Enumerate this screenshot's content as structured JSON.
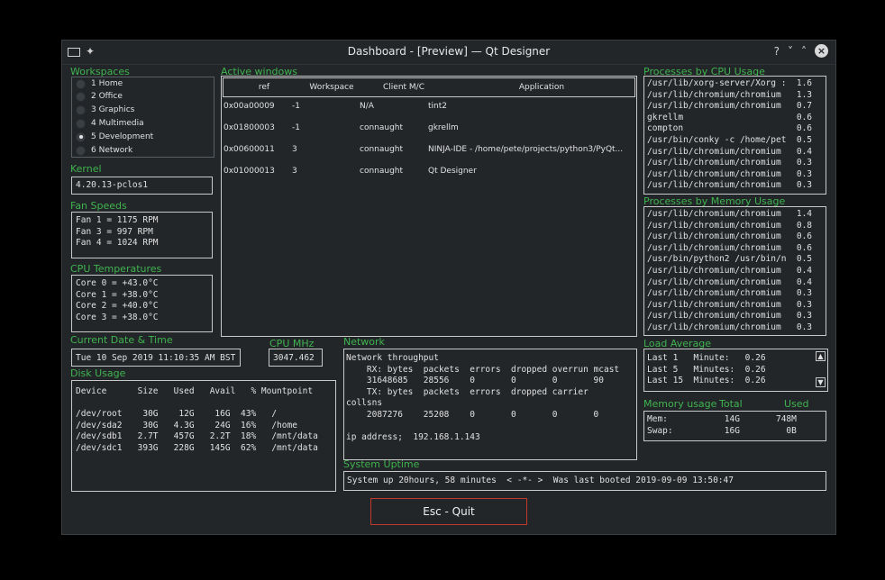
{
  "titlebar": {
    "title": "Dashboard - [Preview] — Qt Designer",
    "left_icons": [
      "window-menu-icon",
      "pin-icon"
    ],
    "help": "?",
    "minimize": "˅",
    "maximize": "˄",
    "close": "×"
  },
  "workspaces": {
    "label": "Workspaces",
    "items": [
      {
        "label": "1 Home",
        "selected": false
      },
      {
        "label": "2 Office",
        "selected": false
      },
      {
        "label": "3 Graphics",
        "selected": false
      },
      {
        "label": "4 Multimedia",
        "selected": false
      },
      {
        "label": "5 Development",
        "selected": true
      },
      {
        "label": "6 Network",
        "selected": false
      }
    ]
  },
  "kernel": {
    "label": "Kernel",
    "value": "4.20.13-pclos1"
  },
  "fans": {
    "label": "Fan Speeds",
    "text": "Fan 1 = 1175 RPM\nFan 3 = 997 RPM\nFan 4 = 1024 RPM"
  },
  "cpu_temps": {
    "label": "CPU Temperatures",
    "text": "Core 0 = +43.0°C\nCore 1 = +38.0°C\nCore 2 = +40.0°C\nCore 3 = +38.0°C"
  },
  "datetime": {
    "label": "Current Date & Time",
    "value": "Tue 10 Sep 2019 11:10:35 AM BST"
  },
  "cpu_mhz": {
    "label": "CPU MHz",
    "value": "3047.462"
  },
  "disk": {
    "label": "Disk Usage",
    "text": "Device      Size   Used   Avail   % Mountpoint\n\n/dev/root    30G    12G    16G  43%   /\n/dev/sda2    30G   4.3G    24G  16%   /home\n/dev/sdb1   2.7T   457G   2.2T  18%   /mnt/data\n/dev/sdc1   393G   228G   145G  62%   /mnt/data"
  },
  "active_windows": {
    "label": "Active windows",
    "headers": [
      "ref",
      "Workspace",
      "Client M/C",
      "Application"
    ],
    "rows": [
      [
        "0x00a00009",
        "-1",
        "N/A",
        "tint2"
      ],
      [
        "0x01800003",
        "-1",
        "connaught",
        "gkrellm"
      ],
      [
        "0x00600011",
        "3",
        "connaught",
        "NINJA-IDE - /home/pete/projects/python3/PyQt..."
      ],
      [
        "0x01000013",
        "3",
        "connaught",
        "Qt Designer"
      ]
    ]
  },
  "network": {
    "label": "Network",
    "text": "Network throughput\n    RX: bytes  packets  errors  dropped overrun mcast\n    31648685   28556    0       0       0       90\n    TX: bytes  packets  errors  dropped carrier\ncollsns\n    2087276    25208    0       0       0       0\n\nip address;  192.168.1.143"
  },
  "uptime": {
    "label": "System Uptime",
    "value": "System up 20hours, 58 minutes  < -*- >  Was last booted 2019-09-09 13:50:47"
  },
  "proc_cpu": {
    "label": "Processes by CPU Usage",
    "text": "/usr/lib/xorg-server/Xorg :  1.6\n/usr/lib/chromium/chromium   1.3\n/usr/lib/chromium/chromium   0.7\ngkrellm                      0.6\ncompton                      0.6\n/usr/bin/conky -c /home/pet  0.5\n/usr/lib/chromium/chromium   0.4\n/usr/lib/chromium/chromium   0.3\n/usr/lib/chromium/chromium   0.3\n/usr/lib/chromium/chromium   0.3"
  },
  "proc_mem": {
    "label": "Processes by Memory Usage",
    "text": "/usr/lib/chromium/chromium   1.4\n/usr/lib/chromium/chromium   0.8\n/usr/lib/chromium/chromium   0.6\n/usr/lib/chromium/chromium   0.6\n/usr/bin/python2 /usr/bin/n  0.5\n/usr/lib/chromium/chromium   0.4\n/usr/lib/chromium/chromium   0.4\n/usr/lib/chromium/chromium   0.3\n/usr/lib/chromium/chromium   0.3\n/usr/lib/chromium/chromium   0.3\n/usr/lib/chromium/chromium   0.3"
  },
  "load": {
    "label": "Load Average",
    "text": "Last 1   Minute:   0.26\nLast 5   Minutes:  0.26\nLast 15  Minutes:  0.26"
  },
  "memory": {
    "label": "Memory usage",
    "col_total": "Total",
    "col_used": "Used",
    "text": "Mem:           14G       748M\nSwap:          16G         0B"
  },
  "quit": {
    "label": "Esc - Quit"
  }
}
